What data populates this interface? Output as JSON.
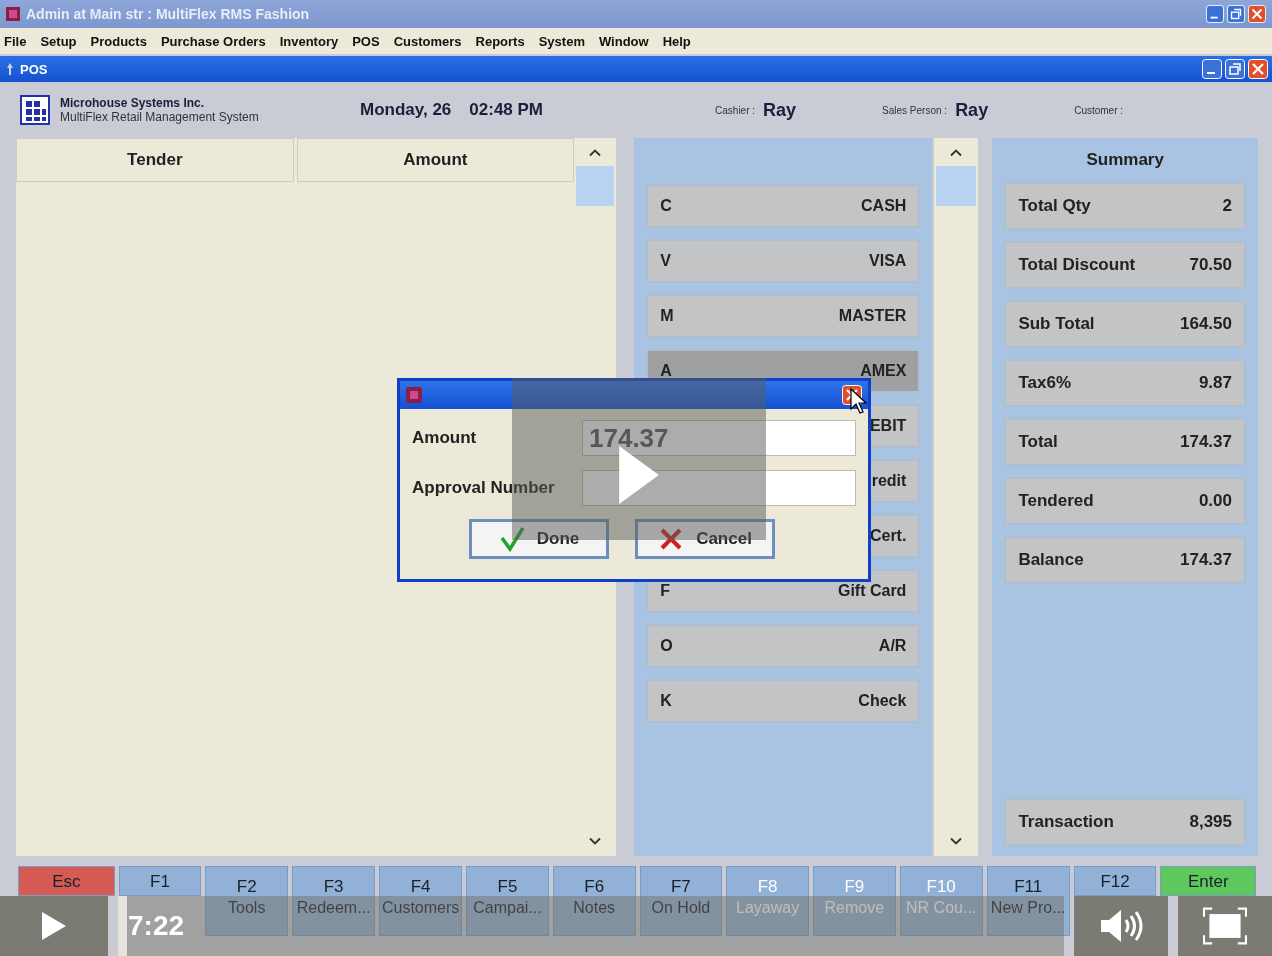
{
  "window": {
    "title": "Admin at Main str :  MultiFlex RMS Fashion"
  },
  "menu": [
    "File",
    "Setup",
    "Products",
    "Purchase Orders",
    "Inventory",
    "POS",
    "Customers",
    "Reports",
    "System",
    "Window",
    "Help"
  ],
  "child_window": {
    "title": "POS"
  },
  "header": {
    "company": "Microhouse Systems Inc.",
    "product": "MultiFlex Retail Management System",
    "date": "Monday, 26",
    "time": "02:48 PM",
    "cashier_label": "Cashier :",
    "cashier": "Ray",
    "sales_person_label": "Sales Person :",
    "sales_person": "Ray",
    "customer_label": "Customer :"
  },
  "tender_table": {
    "columns": [
      "Tender",
      "Amount"
    ]
  },
  "tender_buttons": [
    {
      "key": "C",
      "label": "CASH",
      "selected": false
    },
    {
      "key": "V",
      "label": "VISA",
      "selected": false
    },
    {
      "key": "M",
      "label": "MASTER",
      "selected": false
    },
    {
      "key": "A",
      "label": "AMEX",
      "selected": true
    },
    {
      "label": "EBIT",
      "selected": false
    },
    {
      "label": "redit",
      "selected": false
    },
    {
      "label": "Cert.",
      "selected": false
    },
    {
      "key": "F",
      "label": "Gift Card",
      "selected": false
    },
    {
      "key": "O",
      "label": "A/R",
      "selected": false
    },
    {
      "key": "K",
      "label": "Check",
      "selected": false
    }
  ],
  "summary": {
    "title": "Summary",
    "rows": [
      {
        "label": "Total Qty",
        "value": "2"
      },
      {
        "label": "Total Discount",
        "value": "70.50"
      },
      {
        "label": "Sub Total",
        "value": "164.50"
      },
      {
        "label": "Tax6%",
        "value": "9.87"
      },
      {
        "label": "Total",
        "value": "174.37"
      },
      {
        "label": "Tendered",
        "value": "0.00"
      },
      {
        "label": "Balance",
        "value": "174.37"
      }
    ],
    "footer": {
      "label": "Transaction",
      "value": "8,395"
    }
  },
  "dialog": {
    "amount_label": "Amount",
    "amount": "174.37",
    "approval_label": "Approval Number",
    "buttons": [
      {
        "kind": "confirm",
        "label": "Done"
      },
      {
        "kind": "cancel",
        "label": "Cancel"
      }
    ]
  },
  "function_keys": [
    {
      "kind": "escape",
      "key": "Esc",
      "disabled": false
    },
    {
      "kind": "fn",
      "key": "F1",
      "disabled": false
    },
    {
      "kind": "fn",
      "key": "F2",
      "label": "Tools",
      "disabled": false
    },
    {
      "kind": "fn",
      "key": "F3",
      "label": "Redeem...",
      "disabled": false
    },
    {
      "kind": "fn",
      "key": "F4",
      "label": "Customers",
      "disabled": false
    },
    {
      "kind": "fn",
      "key": "F5",
      "label": "Campai...",
      "disabled": false
    },
    {
      "kind": "fn",
      "key": "F6",
      "label": "Notes",
      "disabled": false
    },
    {
      "kind": "fn",
      "key": "F7",
      "label": "On Hold",
      "disabled": false
    },
    {
      "kind": "fn",
      "key": "F8",
      "label": "Layaway",
      "disabled": true
    },
    {
      "kind": "fn",
      "key": "F9",
      "label": "Remove",
      "disabled": true
    },
    {
      "kind": "fn",
      "key": "F10",
      "label": "NR Cou...",
      "disabled": true
    },
    {
      "kind": "fn",
      "key": "F11",
      "label": "New Pro...",
      "disabled": false
    },
    {
      "kind": "fn",
      "key": "F12",
      "disabled": false
    },
    {
      "kind": "enter",
      "key": "Enter",
      "disabled": false
    }
  ],
  "video": {
    "time": "7:22",
    "level": 0.01
  }
}
